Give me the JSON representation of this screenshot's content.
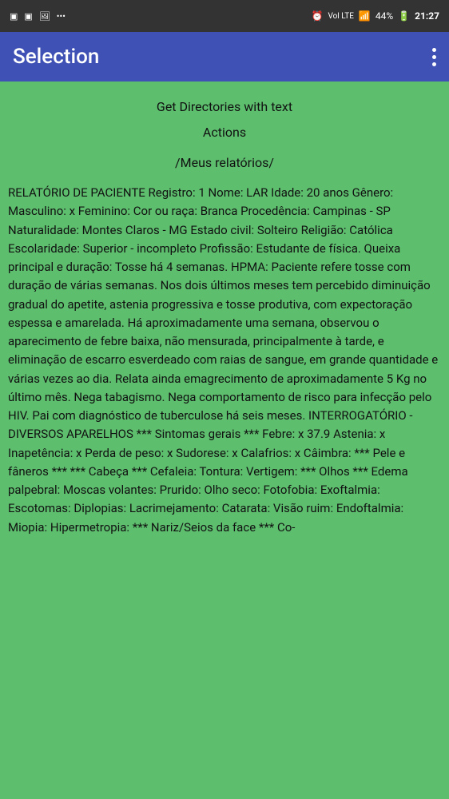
{
  "statusBar": {
    "leftIcons": [
      "⬛",
      "⬛",
      "🖼"
    ],
    "time": "21:27",
    "battery": "44%",
    "signal": "Vol LTE",
    "wifi": "WiFi"
  },
  "appBar": {
    "title": "Selection",
    "menuIcon": "⋮"
  },
  "content": {
    "header": "Get Directories with text",
    "subheader": "Actions",
    "sectionLabel": "/Meus relatórios/",
    "reportText": "RELATÓRIO DE PACIENTE Registro: 1 Nome: LAR Idade: 20 anos Gênero: Masculino: x Feminino: Cor ou raça: Branca Procedência: Campinas - SP Naturalidade: Montes Claros - MG Estado civil: Solteiro Religião: Católica Escolaridade: Superior - incompleto Profissão: Estudante de física. Queixa principal e duração: Tosse há 4 semanas. HPMA: Paciente refere tosse com duração de várias semanas. Nos dois últimos meses tem percebido diminuição gradual do apetite, astenia progressiva e tosse produtiva, com expectoração espessa e amarelada. Há aproximadamente uma semana, observou o aparecimento de febre baixa, não mensurada, principalmente à tarde, e eliminação de escarro esverdeado com raias de sangue, em grande quantidade e várias vezes ao dia. Relata ainda emagrecimento de aproximadamente 5 Kg no último mês. Nega tabagismo. Nega comportamento de risco para infecção pelo HIV. Pai com diagnóstico de tuberculose há seis meses. INTERROGATÓRIO - DIVERSOS APARELHOS *** Sintomas gerais *** Febre: x 37.9 Astenia: x Inapetência: x Perda de peso: x Sudorese: x Calafrios: x Câimbra: *** Pele e fâneros *** *** Cabeça *** Cefaleia: Tontura: Vertigem: *** Olhos *** Edema palpebral: Moscas volantes: Prurido: Olho seco: Fotofobia: Exoftalmia: Escotomas: Diplopias: Lacrimejamento: Catarata: Visão ruim: Endoftalmia: Miopia: Hipermetropia: *** Nariz/Seios da face *** Co-"
  }
}
